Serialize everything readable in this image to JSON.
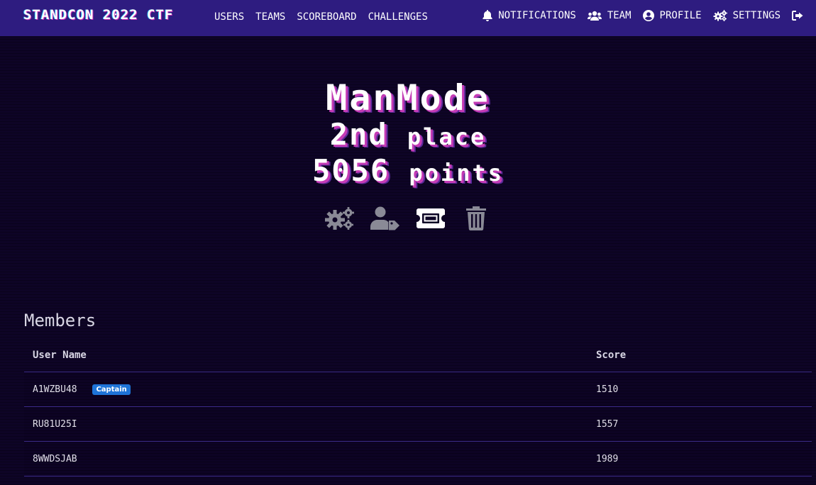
{
  "brand": "STANDCON 2022 CTF",
  "nav": {
    "left": [
      "USERS",
      "TEAMS",
      "SCOREBOARD",
      "CHALLENGES"
    ],
    "right": {
      "notifications": "NOTIFICATIONS",
      "team": "TEAM",
      "profile": "PROFILE",
      "settings": "SETTINGS"
    }
  },
  "team": {
    "name": "ManMode",
    "place_num": "2nd",
    "place_word": "place",
    "points_num": "5056",
    "points_word": "points",
    "actions": [
      "cogs-icon",
      "user-tag-icon",
      "ticket-icon",
      "trash-icon"
    ]
  },
  "members": {
    "title": "Members",
    "columns": [
      "User Name",
      "Score"
    ],
    "rows": [
      {
        "name": "A1WZBU48",
        "badge": "Captain",
        "score": "1510"
      },
      {
        "name": "RU81U25I",
        "badge": "",
        "score": "1557"
      },
      {
        "name": "8WWDSJAB",
        "badge": "",
        "score": "1989"
      }
    ]
  },
  "colors": {
    "navbar": "#2e1c80",
    "background": "#0e0426",
    "accent_shadow": "#c43bb5",
    "badge": "#1e74d8"
  }
}
